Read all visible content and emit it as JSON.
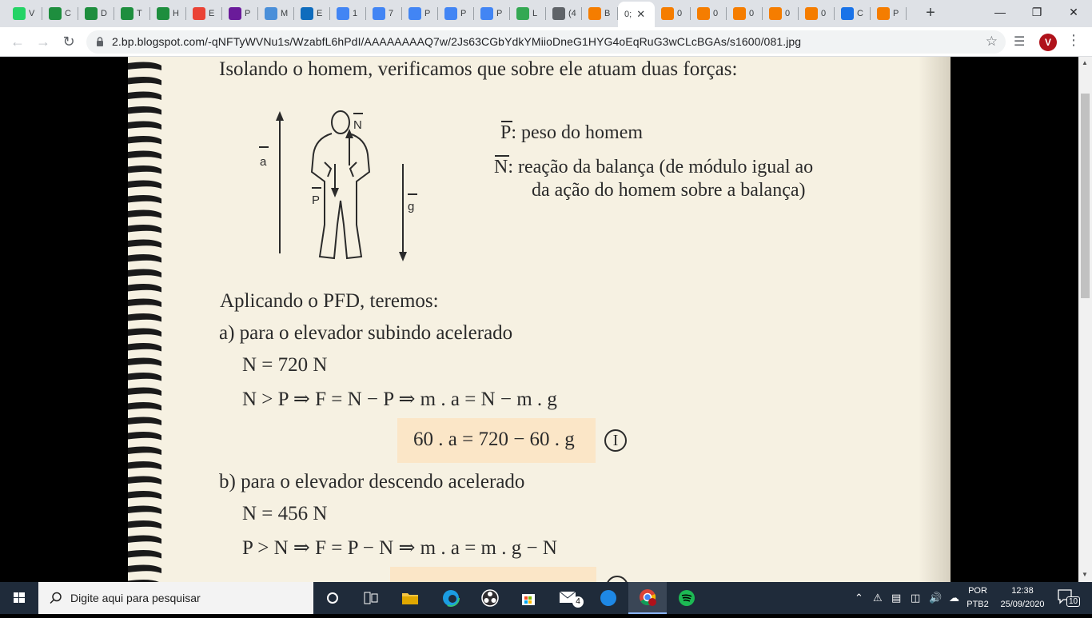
{
  "browser": {
    "tabs": [
      {
        "letter": "V",
        "icon": "whatsapp-icon",
        "color": "#25d366"
      },
      {
        "letter": "C",
        "icon": "classroom-icon",
        "color": "#1e8e3e"
      },
      {
        "letter": "D",
        "icon": "classroom-icon",
        "color": "#1e8e3e"
      },
      {
        "letter": "T",
        "icon": "classroom-icon",
        "color": "#1e8e3e"
      },
      {
        "letter": "H",
        "icon": "classroom-icon",
        "color": "#1e8e3e"
      },
      {
        "letter": "E",
        "icon": "gmail-icon",
        "color": "#ea4335"
      },
      {
        "letter": "P",
        "icon": "purple-app-icon",
        "color": "#6a1b9a"
      },
      {
        "letter": "M",
        "icon": "teams-like-icon",
        "color": "#4a8fd9"
      },
      {
        "letter": "E",
        "icon": "outlook-icon",
        "color": "#0f6cbd"
      },
      {
        "letter": "1",
        "icon": "docs-icon",
        "color": "#4285f4"
      },
      {
        "letter": "7",
        "icon": "docs-icon",
        "color": "#4285f4"
      },
      {
        "letter": "P",
        "icon": "docs-icon",
        "color": "#4285f4"
      },
      {
        "letter": "P",
        "icon": "docs-icon",
        "color": "#4285f4"
      },
      {
        "letter": "P",
        "icon": "docs-icon",
        "color": "#4285f4"
      },
      {
        "letter": "L",
        "icon": "maps-icon",
        "color": "#34a853"
      },
      {
        "letter": "(4",
        "icon": "audio-icon",
        "color": "#5f6368"
      },
      {
        "letter": "B",
        "icon": "blogger-icon",
        "color": "#f57d00"
      },
      {
        "letter": "0;",
        "icon": "",
        "color": "#ffffff",
        "active": true
      },
      {
        "letter": "0",
        "icon": "blogger-icon",
        "color": "#f57d00"
      },
      {
        "letter": "0",
        "icon": "blogger-icon",
        "color": "#f57d00"
      },
      {
        "letter": "0",
        "icon": "blogger-icon",
        "color": "#f57d00"
      },
      {
        "letter": "0",
        "icon": "blogger-icon",
        "color": "#f57d00"
      },
      {
        "letter": "0",
        "icon": "blogger-icon",
        "color": "#f57d00"
      },
      {
        "letter": "C",
        "icon": "link-icon",
        "color": "#1a73e8"
      },
      {
        "letter": "P",
        "icon": "blogger-icon",
        "color": "#f57d00"
      }
    ],
    "url": "2.bp.blogspot.com/-qNFTyWVNu1s/WzabfL6hPdI/AAAAAAAAQ7w/2Js63CGbYdkYMiioDneG1HYG4oEqRuG3wCLcBGAs/s1600/081.jpg",
    "avatar_letter": "V"
  },
  "document": {
    "intro": "Isolando o homem, verificamos que sobre ele atuam duas forças:",
    "figure_labels": {
      "a": "a",
      "N": "N",
      "P": "P",
      "g": "g"
    },
    "legend_P_symbol": "P",
    "legend_P_text": ": peso do homem",
    "legend_N_symbol": "N",
    "legend_N_text": ":  reação da balança (de módulo igual ao",
    "legend_N_text2": "da ação do homem sobre a balança)",
    "pfd_heading": "Aplicando o PFD, teremos:",
    "case_a_title": "a) para o elevador subindo acelerado",
    "case_a_n": "N = 720 N",
    "case_a_eq": "N > P  ⇒  F = N − P  ⇒  m . a = N − m . g",
    "case_a_boxed": "60 . a = 720 − 60 . g",
    "case_a_label": "I",
    "case_b_title": "b) para o elevador descendo acelerado",
    "case_b_n": "N = 456 N",
    "case_b_eq": "P > N  ⇒  F = P − N  ⇒  m . a = m . g − N"
  },
  "taskbar": {
    "search_placeholder": "Digite aqui para pesquisar",
    "mail_badge": "4",
    "lang_top": "POR",
    "lang_bottom": "PTB2",
    "time": "12:38",
    "date": "25/09/2020",
    "notifications": "10"
  }
}
